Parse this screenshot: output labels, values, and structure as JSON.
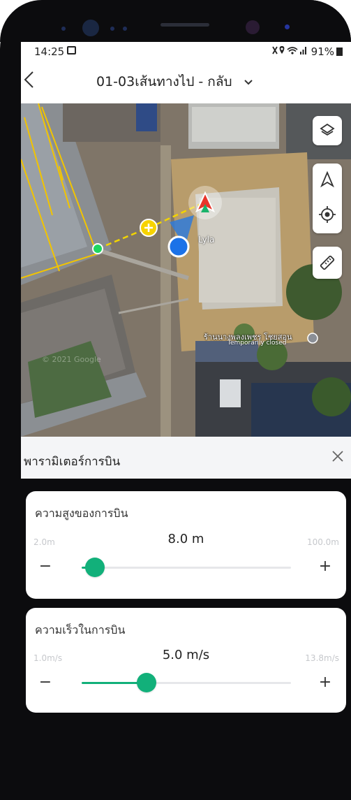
{
  "status_bar": {
    "time": "14:25",
    "battery": "91%"
  },
  "header": {
    "back_icon": "chevron-left-icon",
    "title": "01-03เส้นทางไป - กลับ",
    "dropdown_icon": "chevron-down-icon"
  },
  "map": {
    "aircraft_label": "Lyla",
    "place_name": "ร้านนางพลงเพชร โชยสอน",
    "place_status": "Temporarily closed",
    "watermark": "© 2021 Google",
    "buttons": [
      "layers-icon",
      "navigation-icon",
      "locate-icon",
      "ruler-icon"
    ]
  },
  "panel": {
    "title": "พารามิเตอร์การบิน",
    "close_icon": "close-icon",
    "altitude": {
      "label": "ความสูงของการบิน",
      "value": "8.0 m",
      "min": "2.0m",
      "max": "100.0m",
      "fraction": 0.063
    },
    "speed": {
      "label": "ความเร็วในการบิน",
      "value": "5.0 m/s",
      "min": "1.0m/s",
      "max": "13.8m/s",
      "fraction": 0.31
    },
    "minus": "−",
    "plus": "+"
  },
  "colors": {
    "accent": "#12b07a"
  }
}
